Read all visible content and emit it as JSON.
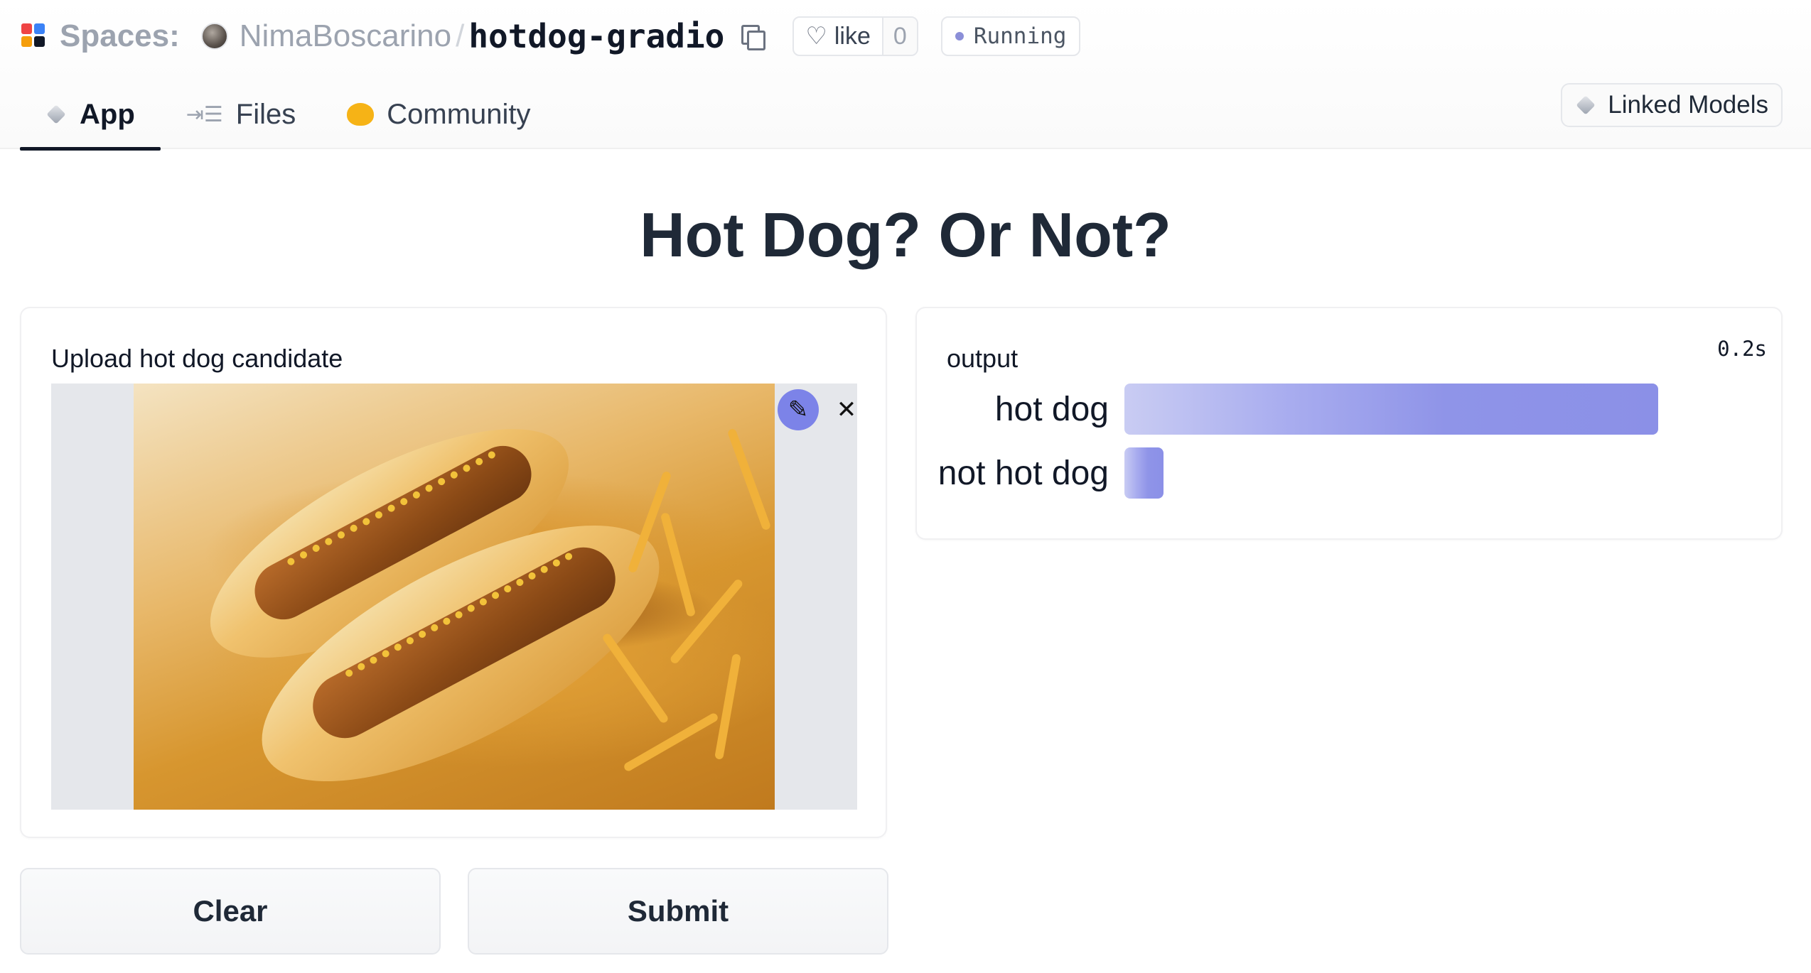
{
  "header": {
    "spaces_label": "Spaces:",
    "owner": "NimaBoscarino",
    "separator": "/",
    "repo": "hotdog-gradio",
    "like_label": "like",
    "like_count": "0",
    "status": "Running"
  },
  "tabs": [
    {
      "label": "App",
      "active": true,
      "icon": "cube-icon"
    },
    {
      "label": "Files",
      "active": false,
      "icon": "files-icon"
    },
    {
      "label": "Community",
      "active": false,
      "icon": "community-icon"
    }
  ],
  "linked_models_label": "Linked Models",
  "app": {
    "title": "Hot Dog? Or Not?",
    "input": {
      "label": "Upload hot dog candidate",
      "image_alt": "Hot dogs with mustard and fries"
    },
    "output": {
      "label": "output",
      "latency": "0.2s",
      "confidences": [
        {
          "label": "hot dog",
          "value": 0.95
        },
        {
          "label": "not hot dog",
          "value": 0.07
        }
      ]
    },
    "buttons": {
      "clear": "Clear",
      "submit": "Submit"
    }
  },
  "colors": {
    "accent": "#8b90e7",
    "status_dot": "#8b8fd8",
    "community": "#f6b316"
  }
}
